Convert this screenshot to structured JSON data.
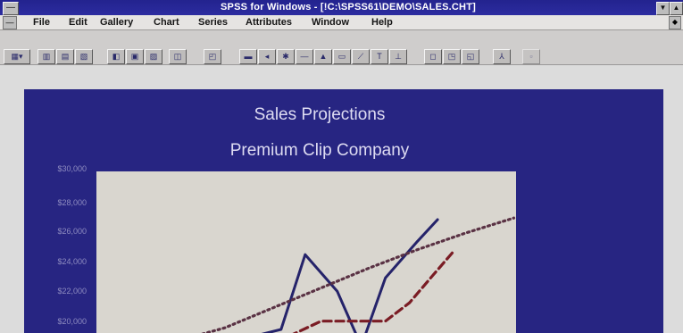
{
  "window": {
    "title": "SPSS for Windows - [!C:\\SPSS61\\DEMO\\SALES.CHT]",
    "titlebar_color": "#23238e"
  },
  "menubar": {
    "items": [
      "File",
      "Edit",
      "Gallery",
      "Chart",
      "Series",
      "Attributes",
      "Window",
      "Help"
    ]
  },
  "toolbar": {
    "icons": [
      "chart-type-icon",
      "gallery-bar-icon",
      "gallery-line-icon",
      "gallery-area-icon",
      "gallery-pie-icon",
      "gallery-hilo-icon",
      "gallery-mixed-icon",
      "chart-options-icon",
      "text-icon",
      "color-icon",
      "pattern-icon",
      "marker-icon",
      "line-style-icon",
      "bar-style-icon",
      "interpolation-icon",
      "font-icon",
      "swap-axes-icon",
      "explode-icon",
      "break-line-icon",
      "spin-icon",
      "point-id-icon",
      "label-icon"
    ]
  },
  "chart_data": {
    "type": "line",
    "title": "Sales Projections",
    "subtitle": "Premium Clip Company",
    "ytick_labels": [
      "$30,000",
      "$28,000",
      "$26,000",
      "$24,000",
      "$22,000",
      "$20,000"
    ],
    "ylim": [
      19000,
      30000
    ],
    "xlim": [
      0,
      10.5
    ],
    "series": [
      {
        "color": "#25236a",
        "style": "solid",
        "x": [
          3.6,
          4.6,
          5.2,
          6.0,
          6.6,
          7.2,
          8.0,
          8.5
        ],
        "y": [
          19900,
          20500,
          25000,
          22800,
          19500,
          23600,
          25800,
          27100
        ]
      },
      {
        "color": "#7a1c24",
        "style": "dashed",
        "x": [
          4.8,
          5.6,
          6.4,
          7.2,
          7.8,
          8.4,
          8.9
        ],
        "y": [
          20100,
          21000,
          21000,
          21000,
          22100,
          23800,
          25200
        ]
      },
      {
        "color": "#5a3244",
        "style": "dotted",
        "x": [
          2.0,
          3.2,
          4.4,
          5.6,
          6.8,
          8.0,
          9.2,
          10.4
        ],
        "y": [
          19800,
          20600,
          21800,
          23000,
          24200,
          25300,
          26300,
          27200
        ]
      }
    ]
  }
}
